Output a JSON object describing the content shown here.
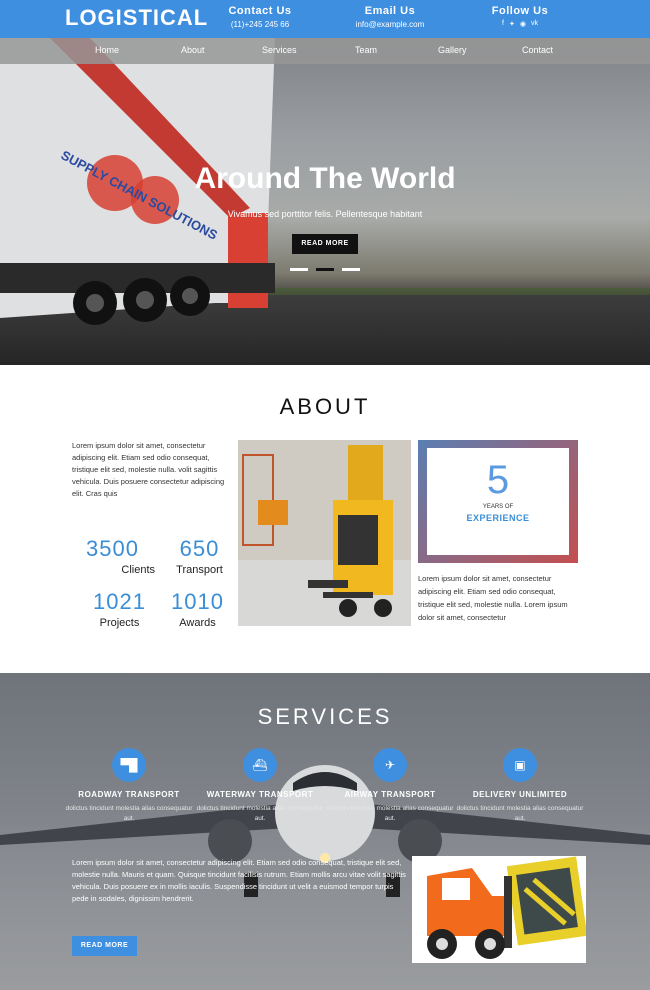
{
  "header": {
    "logo": "LOGISTICAL",
    "contact": {
      "title": "Contact Us",
      "value": "(11)+245 245 66"
    },
    "email": {
      "title": "Email Us",
      "value": "info@example.com"
    },
    "follow": {
      "title": "Follow Us",
      "icons": [
        "facebook-icon",
        "twitter-icon",
        "rss-icon",
        "vk-icon"
      ]
    }
  },
  "nav": {
    "items": [
      "Home",
      "About",
      "Services",
      "Team",
      "Gallery",
      "Contact"
    ]
  },
  "hero": {
    "title": "Around The World",
    "subtitle": "Vivamus sed porttitor felis. Pellentesque habitant",
    "button": "READ MORE",
    "truck_text": "SUPPLY CHAIN SOLUTIONS",
    "slides": 3,
    "active_slide": 2
  },
  "about": {
    "title": "ABOUT",
    "text": "Lorem ipsum dolor sit amet, consectetur adipiscing elit. Etiam sed odio consequat, tristique elit sed, molestie nulla. volit sagittis vehicula. Duis posuere consectetur adipiscing elit. Cras quis",
    "stats": [
      {
        "number": "3500",
        "label": "Clients"
      },
      {
        "number": "650",
        "label": "Transport"
      },
      {
        "number": "1021",
        "label": "Projects"
      },
      {
        "number": "1010",
        "label": "Awards"
      }
    ],
    "experience": {
      "number": "5",
      "years": "YEARS OF",
      "label": "EXPERIENCE"
    },
    "text2": "Lorem ipsum dolor sit amet, consectetur adipiscing elit. Etiam sed odio consequat, tristique elit sed, molestie nulla. Lorem ipsum dolor sit amet, consectetur"
  },
  "services": {
    "title": "SERVICES",
    "items": [
      {
        "name": "ROADWAY TRANSPORT",
        "desc": "dolictus tincidunt molestia alias consequatur aut.",
        "icon": "truck-icon"
      },
      {
        "name": "WATERWAY TRANSPORT",
        "desc": "dolictus tincidunt molestia alias consequatur aut.",
        "icon": "ship-icon"
      },
      {
        "name": "AIRWAY TRANSPORT",
        "desc": "dolictus tincidunt molestia alias consequatur aut.",
        "icon": "plane-icon"
      },
      {
        "name": "DELIVERY UNLIMITED",
        "desc": "dolictus tincidunt molestia alias consequatur aut.",
        "icon": "bus-icon"
      }
    ],
    "text": "Lorem ipsum dolor sit amet, consectetur adipiscing elit. Etiam sed odio consequat, tristique elit sed, molestie nulla. Mauris et quam. Quisque tincidunt facilisis rutrum. Etiam mollis arcu vitae volit sagittis vehicula. Duis posuere ex in mollis iaculis. Suspendisse tincidunt ut velit a euismod tempor turpis pede in sodales, dignissim hendrerit.",
    "button": "READ MORE"
  },
  "colors": {
    "accent": "#3f8fe0",
    "stat": "#3a8ed6"
  }
}
